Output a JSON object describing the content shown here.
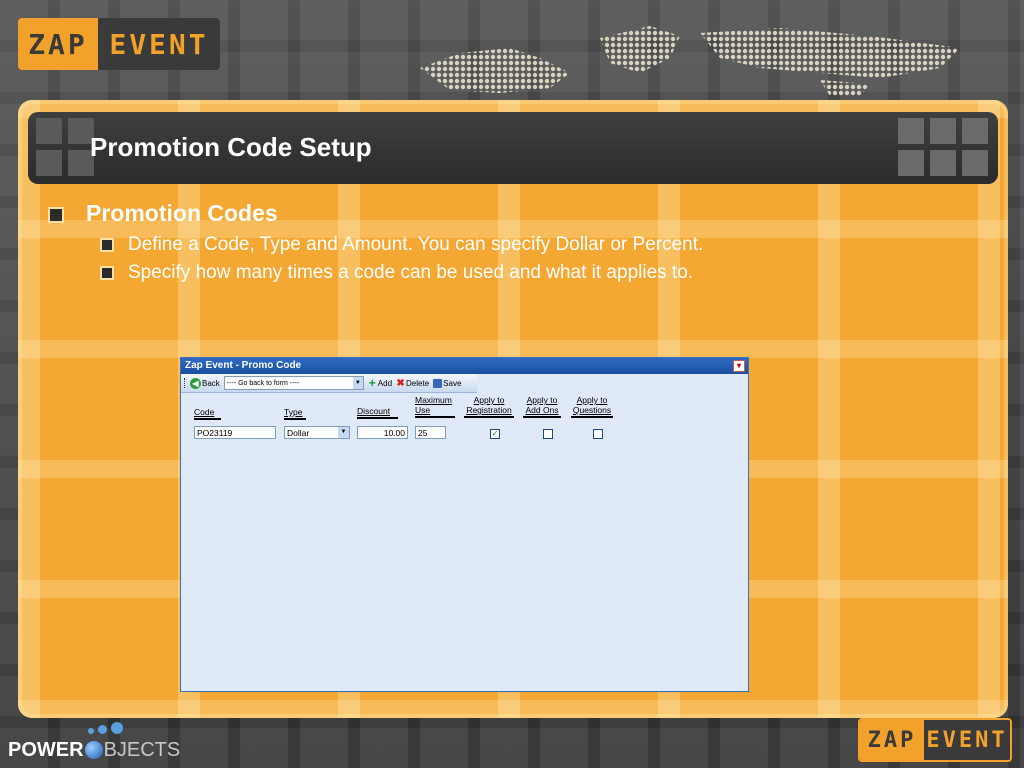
{
  "logo": {
    "zap": "ZAP",
    "event": "EVENT"
  },
  "slide": {
    "title": "Promotion Code Setup",
    "bullet_main": "Promotion Codes",
    "sub_bullets": [
      "Define a Code, Type and Amount. You can specify Dollar or Percent.",
      "Specify how many times a code can be used and what it applies to."
    ]
  },
  "app": {
    "title": "Zap Event - Promo Code",
    "toolbar": {
      "back_label": "Back",
      "nav_select": "---- Go back to form ----",
      "add_label": "Add",
      "delete_label": "Delete",
      "save_label": "Save"
    },
    "columns": {
      "code": "Code",
      "type": "Type",
      "discount": "Discount",
      "max_use_1": "Maximum",
      "max_use_2": "Use",
      "apply_reg_1": "Apply to",
      "apply_reg_2": "Registration",
      "apply_addons_1": "Apply to",
      "apply_addons_2": "Add Ons",
      "apply_q_1": "Apply to",
      "apply_q_2": "Questions"
    },
    "row": {
      "code": "PO23119",
      "type": "Dollar",
      "discount": "10.00",
      "max_use": "25",
      "apply_registration": true,
      "apply_addons": false,
      "apply_questions": false
    }
  },
  "footer": {
    "power": "POWER",
    "objects": "BJECTS"
  },
  "colors": {
    "orange": "#f4a732",
    "window_blue": "#2e6bc4",
    "dark": "#3a3a3a"
  }
}
